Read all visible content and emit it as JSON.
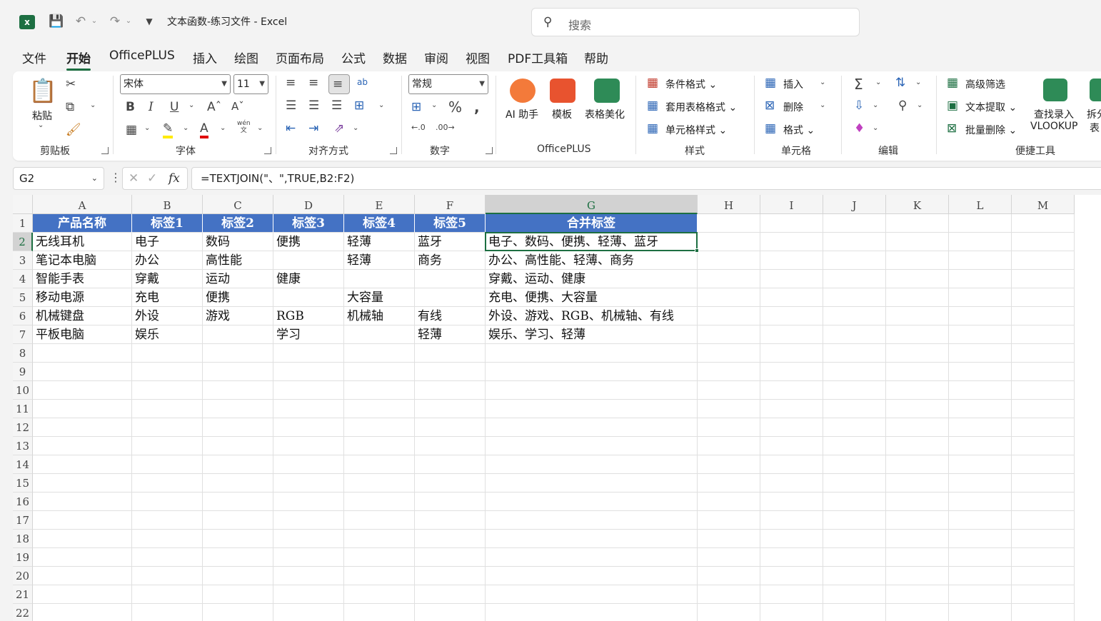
{
  "app": {
    "logo": "x",
    "title": "文本函数-练习文件  -  Excel",
    "search_placeholder": "搜索",
    "accent": "#1d6f42"
  },
  "tabs": [
    {
      "label": "文件"
    },
    {
      "label": "开始",
      "active": true
    },
    {
      "label": "OfficePLUS"
    },
    {
      "label": "插入"
    },
    {
      "label": "绘图"
    },
    {
      "label": "页面布局"
    },
    {
      "label": "公式"
    },
    {
      "label": "数据"
    },
    {
      "label": "审阅"
    },
    {
      "label": "视图"
    },
    {
      "label": "PDF工具箱"
    },
    {
      "label": "帮助"
    }
  ],
  "ribbon": {
    "clipboard": {
      "paste": "粘贴",
      "label": "剪贴板"
    },
    "font": {
      "name": "宋体",
      "size": "11",
      "label": "字体",
      "phonetic": "wén",
      "phonetic_char": "文"
    },
    "alignment": {
      "label": "对齐方式",
      "wrap_text": "ab"
    },
    "number": {
      "format": "常规",
      "label": "数字"
    },
    "officeplus": {
      "ai": "AI 助手",
      "template": "模板",
      "beautify": "表格美化",
      "label": "OfficePLUS"
    },
    "styles": {
      "conditional": "条件格式",
      "table_format": "套用表格格式",
      "cell_styles": "单元格样式",
      "label": "样式"
    },
    "cells": {
      "insert": "插入",
      "delete": "删除",
      "format": "格式",
      "label": "单元格"
    },
    "editing": {
      "label": "编辑"
    },
    "quick": {
      "adv_filter": "高级筛选",
      "text_extract": "文本提取",
      "batch_delete": "批量删除",
      "lookup_line1": "查找录入",
      "lookup_line2": "VLOOKUP",
      "split_line1": "拆分",
      "split_line2": "表",
      "label": "便捷工具"
    }
  },
  "formula_bar": {
    "name_box": "G2",
    "formula": "=TEXTJOIN(\"、\",TRUE,B2:F2)"
  },
  "sheet": {
    "columns": [
      "A",
      "B",
      "C",
      "D",
      "E",
      "F",
      "G",
      "H",
      "I",
      "J",
      "K",
      "L",
      "M"
    ],
    "row_numbers": [
      "1",
      "2",
      "3",
      "4",
      "5",
      "6",
      "7",
      "8",
      "9",
      "10",
      "11",
      "12",
      "13",
      "14",
      "15",
      "16",
      "17",
      "18",
      "19",
      "20",
      "21",
      "22"
    ],
    "header": [
      "产品名称",
      "标签1",
      "标签2",
      "标签3",
      "标签4",
      "标签5",
      "合并标签"
    ],
    "rows": [
      [
        "无线耳机",
        "电子",
        "数码",
        "便携",
        "轻薄",
        "蓝牙",
        "电子、数码、便携、轻薄、蓝牙"
      ],
      [
        "笔记本电脑",
        "办公",
        "高性能",
        "",
        "轻薄",
        "商务",
        "办公、高性能、轻薄、商务"
      ],
      [
        "智能手表",
        "穿戴",
        "运动",
        "健康",
        "",
        "",
        "穿戴、运动、健康"
      ],
      [
        "移动电源",
        "充电",
        "便携",
        "",
        "大容量",
        "",
        "充电、便携、大容量"
      ],
      [
        "机械键盘",
        "外设",
        "游戏",
        "RGB",
        "机械轴",
        "有线",
        "外设、游戏、RGB、机械轴、有线"
      ],
      [
        "平板电脑",
        "娱乐",
        "",
        "学习",
        "",
        "轻薄",
        "娱乐、学习、轻薄"
      ]
    ],
    "active_cell": "G2",
    "header_fill": "#4472c4"
  }
}
